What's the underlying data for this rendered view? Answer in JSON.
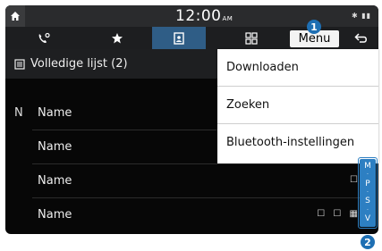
{
  "status_bar": {
    "time": "12:00",
    "ampm": "AM",
    "icons": [
      "bluetooth-icon",
      "signal-icon"
    ]
  },
  "tabs": [
    {
      "name": "recent-calls",
      "icon": "phone-recent-icon"
    },
    {
      "name": "favorites",
      "icon": "star-icon"
    },
    {
      "name": "contacts",
      "icon": "contacts-icon",
      "active": true
    },
    {
      "name": "keypad",
      "icon": "keypad-icon"
    }
  ],
  "menu_label": "Menu",
  "list": {
    "header": "Volledige lijst (2)",
    "rows": [
      {
        "index": "N",
        "name": "Name",
        "icons": ""
      },
      {
        "index": "",
        "name": "Name",
        "icons": ""
      },
      {
        "index": "",
        "name": "Name",
        "icons": "☐"
      },
      {
        "index": "",
        "name": "Name",
        "icons": "☐ ☐ ▦"
      }
    ]
  },
  "menu_dropdown": {
    "items": [
      "Downloaden",
      "Zoeken",
      "Bluetooth-instellingen"
    ]
  },
  "index_bar": {
    "letters": [
      "M",
      "P",
      "S",
      "V"
    ]
  },
  "callouts": [
    "1",
    "2"
  ],
  "colors": {
    "accent": "#2d7fc2",
    "active_tab": "#2f5d86",
    "background": "#070707"
  }
}
